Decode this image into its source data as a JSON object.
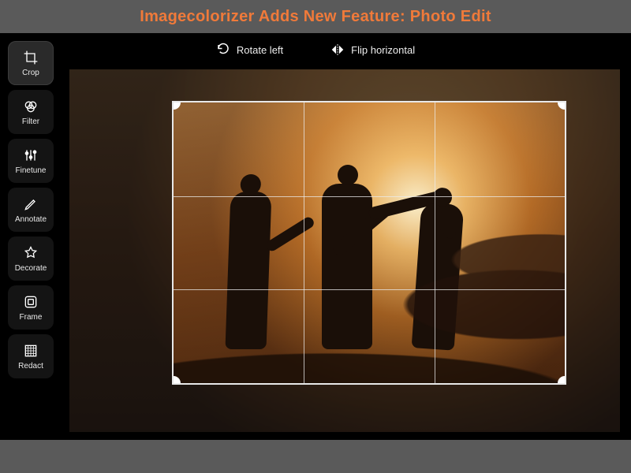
{
  "banner": {
    "title": "Imagecolorizer Adds New Feature: Photo Edit"
  },
  "topbar": {
    "rotate_left_label": "Rotate left",
    "flip_horizontal_label": "Flip horizontal"
  },
  "sidebar": {
    "active_tool": "crop",
    "tools": [
      {
        "id": "crop",
        "label": "Crop",
        "icon": "crop-icon"
      },
      {
        "id": "filter",
        "label": "Filter",
        "icon": "filter-icon"
      },
      {
        "id": "finetune",
        "label": "Finetune",
        "icon": "finetune-icon"
      },
      {
        "id": "annotate",
        "label": "Annotate",
        "icon": "annotate-icon"
      },
      {
        "id": "decorate",
        "label": "Decorate",
        "icon": "decorate-icon"
      },
      {
        "id": "frame",
        "label": "Frame",
        "icon": "frame-icon"
      },
      {
        "id": "redact",
        "label": "Redact",
        "icon": "redact-icon"
      }
    ]
  },
  "colors": {
    "accent": "#f07a3a",
    "bg_app": "#000000",
    "bg_chrome": "#5a5a5a",
    "tool_bg": "#141414",
    "tool_bg_active": "#2a2a2a"
  }
}
